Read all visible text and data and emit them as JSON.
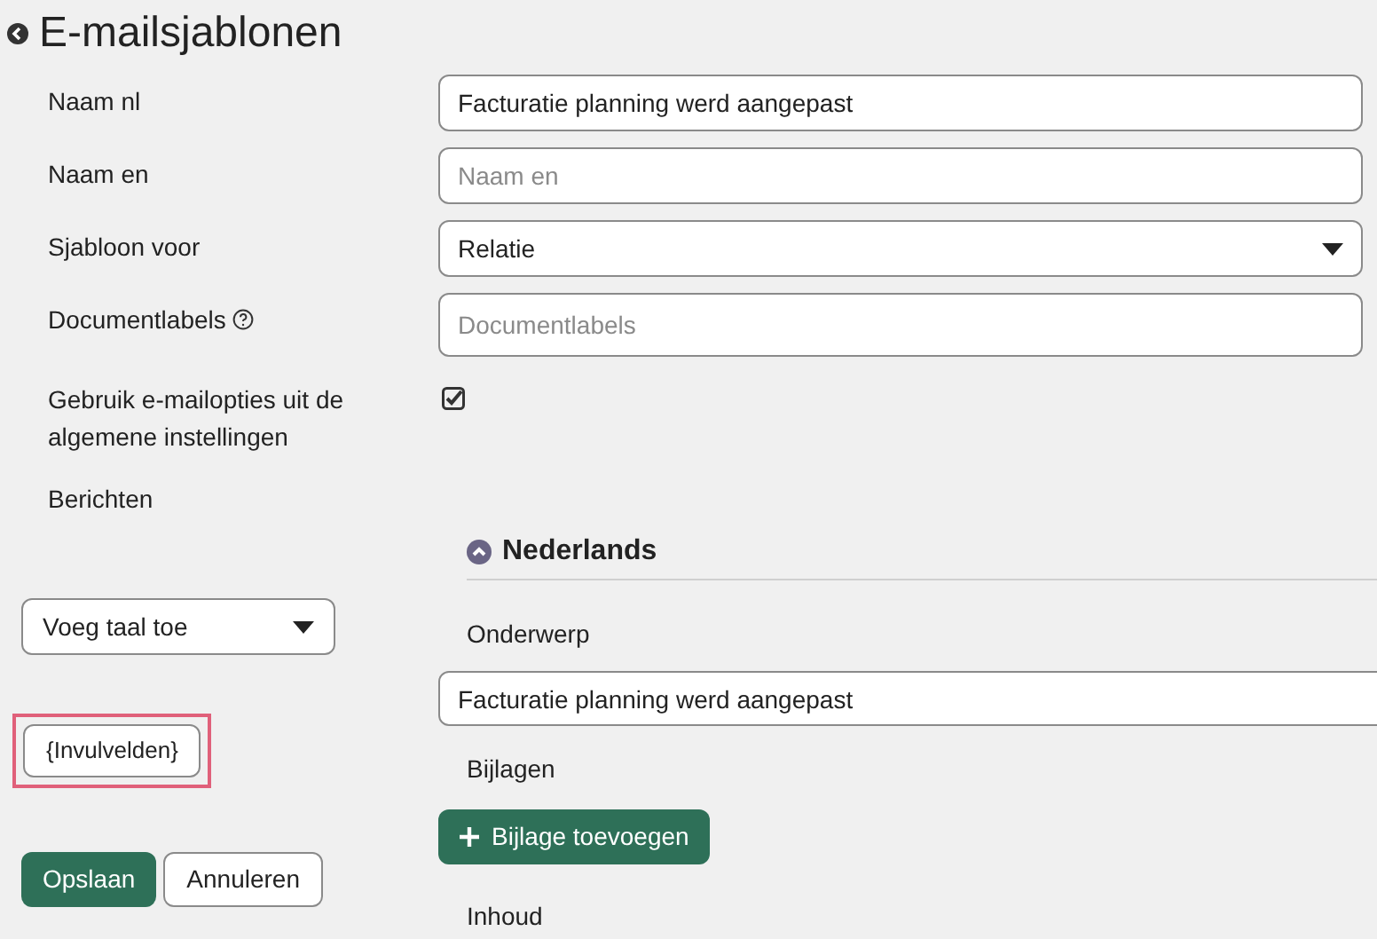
{
  "page": {
    "title": "E-mailsjablonen"
  },
  "fields": [
    {
      "kind": "text",
      "label": "Naam nl",
      "value": "Facturatie planning werd aangepast"
    },
    {
      "kind": "text",
      "label": "Naam en",
      "placeholder": "Naam en"
    },
    {
      "kind": "select",
      "label": "Sjabloon voor",
      "value": "Relatie"
    },
    {
      "kind": "text",
      "label": "Documentlabels",
      "help": true,
      "placeholder": "Documentlabels"
    },
    {
      "kind": "checkbox",
      "label": "Gebruik e-mailopties uit de algemene instellingen",
      "checked": true
    },
    {
      "kind": "heading",
      "label": "Berichten"
    }
  ],
  "language_select": {
    "value": "Voeg taal toe"
  },
  "placeholders_button": {
    "label": "{Invulvelden}",
    "highlighted": true
  },
  "actions": [
    "Opslaan",
    "Annuleren"
  ],
  "language_section": {
    "title": "Nederlands",
    "expanded": true,
    "subject_label": "Onderwerp",
    "subject_value": "Facturatie planning werd aangepast",
    "attachments_label": "Bijlagen",
    "add_attachment": "Bijlage toevoegen",
    "content_label": "Inhoud"
  }
}
